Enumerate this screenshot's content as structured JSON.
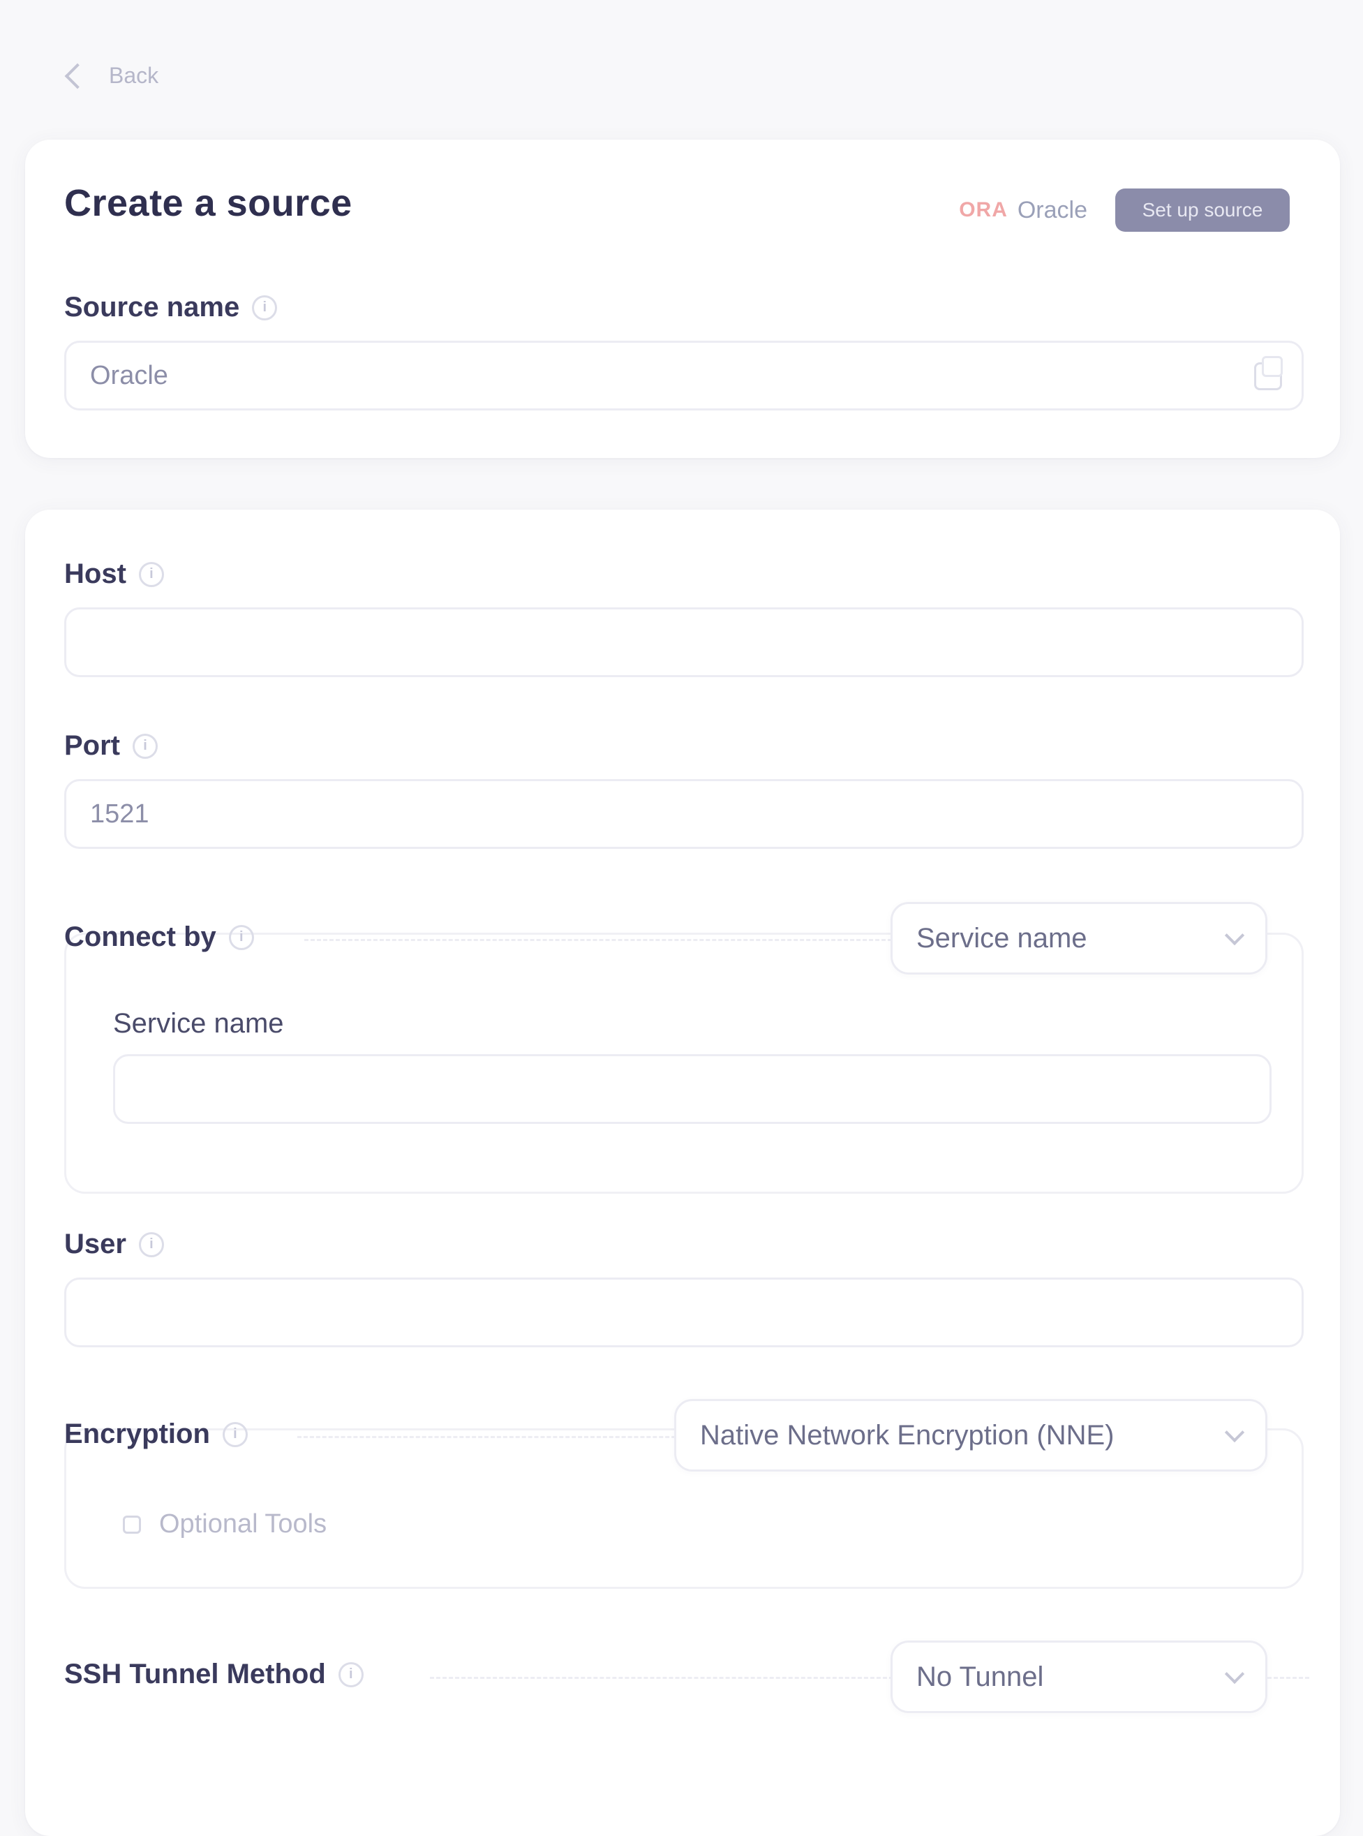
{
  "nav": {
    "back_label": "Back"
  },
  "header": {
    "title": "Create a source",
    "db_logo_text": "ORA",
    "db_name": "Oracle",
    "primary_button_label": "Set up source"
  },
  "source_name": {
    "label": "Source name",
    "value": "Oracle"
  },
  "host": {
    "label": "Host",
    "value": ""
  },
  "port": {
    "label": "Port",
    "value": "1521"
  },
  "connect_by": {
    "label": "Connect by",
    "selected": "Service name",
    "service_name_label": "Service name",
    "service_name_value": ""
  },
  "user": {
    "label": "User",
    "value": ""
  },
  "encryption": {
    "label": "Encryption",
    "selected": "Native Network Encryption (NNE)",
    "option_label": "Optional Tools"
  },
  "ssh": {
    "label": "SSH Tunnel Method",
    "selected": "No Tunnel"
  },
  "icons": {
    "back": "chevron-left-icon",
    "info": "info-icon",
    "copy": "copy-icon",
    "dropdown": "chevron-down-icon"
  },
  "colors": {
    "background": "#f8f8fa",
    "card": "#ffffff",
    "primary_button": "#8b8caa",
    "oracle_accent": "#f0a7a7"
  }
}
